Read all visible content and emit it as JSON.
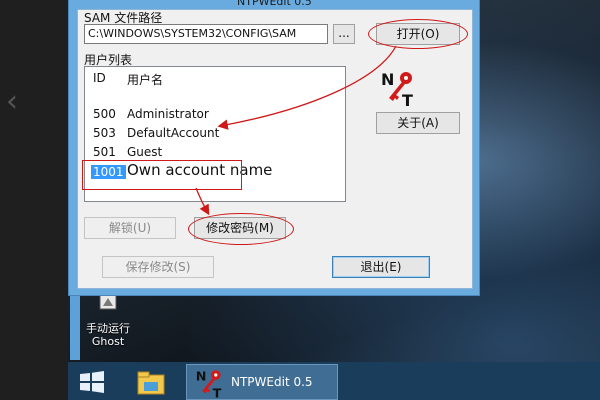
{
  "window": {
    "title": "NTPWEdit 0.5",
    "sam_label": "SAM 文件路径",
    "sam_path": "C:\\WINDOWS\\SYSTEM32\\CONFIG\\SAM",
    "browse_label": "...",
    "open_label": "打开(O)",
    "user_list_label": "用户列表",
    "columns": {
      "id": "ID",
      "name": "用户名"
    },
    "users": [
      {
        "id": "500",
        "name": "Administrator"
      },
      {
        "id": "503",
        "name": "DefaultAccount"
      },
      {
        "id": "501",
        "name": "Guest"
      },
      {
        "id": "1001",
        "name": "Own account name"
      }
    ],
    "about_label": "关于(A)",
    "unlock_label": "解锁(U)",
    "change_password_label": "修改密码(M)",
    "save_label": "保存修改(S)",
    "exit_label": "退出(E)",
    "logo_letters": "NT"
  },
  "desktop": {
    "icon_label_line1": "手动运行",
    "icon_label_line2": "Ghost"
  },
  "taskbar": {
    "ntpw_label": "NTPWEdit 0.5"
  },
  "colors": {
    "annotation": "#d01818",
    "selection": "#3399ff",
    "window_frame": "#6aabdf",
    "taskbar": "#1b3d5c"
  },
  "icons": [
    "windows-start-icon",
    "file-explorer-icon",
    "ntpwedit-key-icon",
    "ghost-shortcut-icon",
    "chevron-left-icon"
  ]
}
